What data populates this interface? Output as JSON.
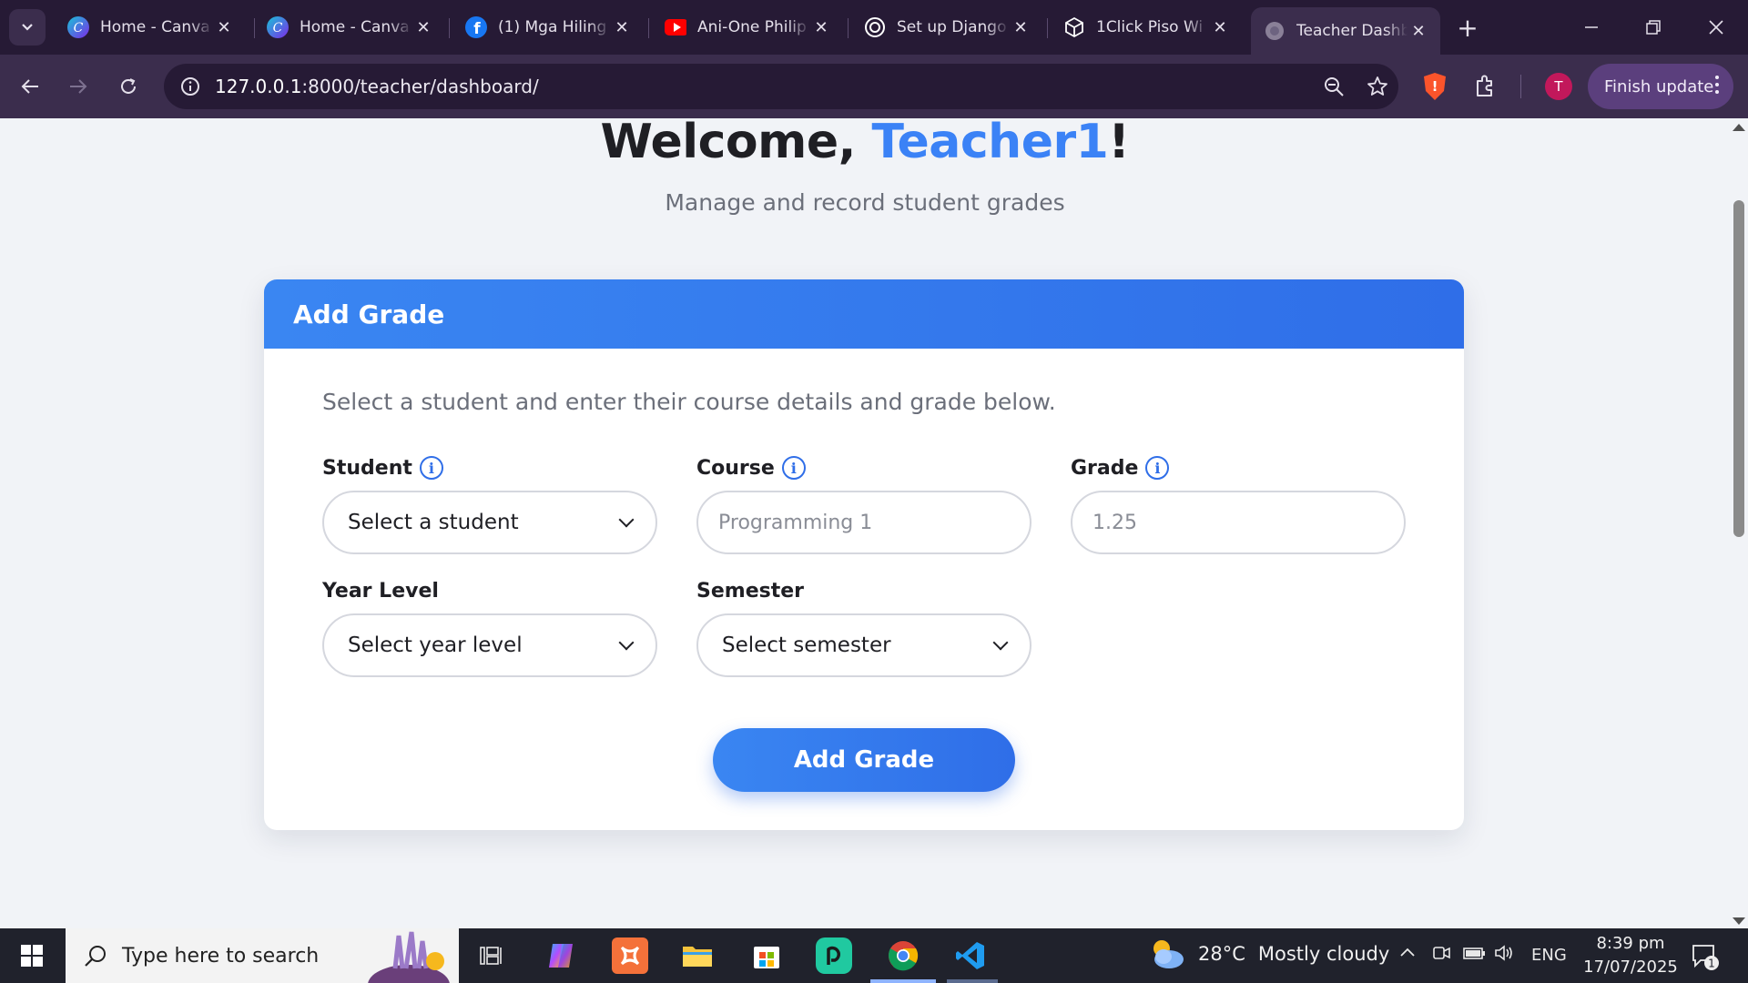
{
  "browser": {
    "tabs": [
      {
        "title": "Home - Canva",
        "icon": "canva-icon"
      },
      {
        "title": "Home - Canva",
        "icon": "canva-icon"
      },
      {
        "title": "(1) Mga Hiling",
        "icon": "facebook-icon"
      },
      {
        "title": "Ani-One Philip",
        "icon": "youtube-icon"
      },
      {
        "title": "Set up Django",
        "icon": "chatgpt-icon"
      },
      {
        "title": "1Click Piso Wi",
        "icon": "package-icon"
      },
      {
        "title": "Teacher Dashb",
        "icon": "globe-icon",
        "active": true
      }
    ],
    "url_host": "127.0.0.1",
    "url_rest": ":8000/teacher/dashboard/",
    "profile_initial": "T",
    "finish_update_label": "Finish update"
  },
  "page": {
    "welcome_prefix": "Welcome, ",
    "teacher_name": "Teacher1",
    "welcome_suffix": "!",
    "subtitle": "Manage and record student grades",
    "card": {
      "title": "Add Grade",
      "description": "Select a student and enter their course details and grade below.",
      "fields": {
        "student": {
          "label": "Student",
          "value": "Select a student"
        },
        "course": {
          "label": "Course",
          "placeholder": "Programming 1"
        },
        "grade": {
          "label": "Grade",
          "placeholder": "1.25"
        },
        "year_level": {
          "label": "Year Level",
          "value": "Select year level"
        },
        "semester": {
          "label": "Semester",
          "value": "Select semester"
        }
      },
      "submit_label": "Add Grade"
    }
  },
  "taskbar": {
    "search_placeholder": "Type here to search",
    "weather_temp": "28°C",
    "weather_text": "Mostly cloudy",
    "language": "ENG",
    "time": "8:39 pm",
    "date": "17/07/2025",
    "notification_count": "1"
  },
  "colors": {
    "accent": "#3b82f6",
    "tabstrip": "#261a35",
    "toolbar": "#3b2d4d"
  }
}
